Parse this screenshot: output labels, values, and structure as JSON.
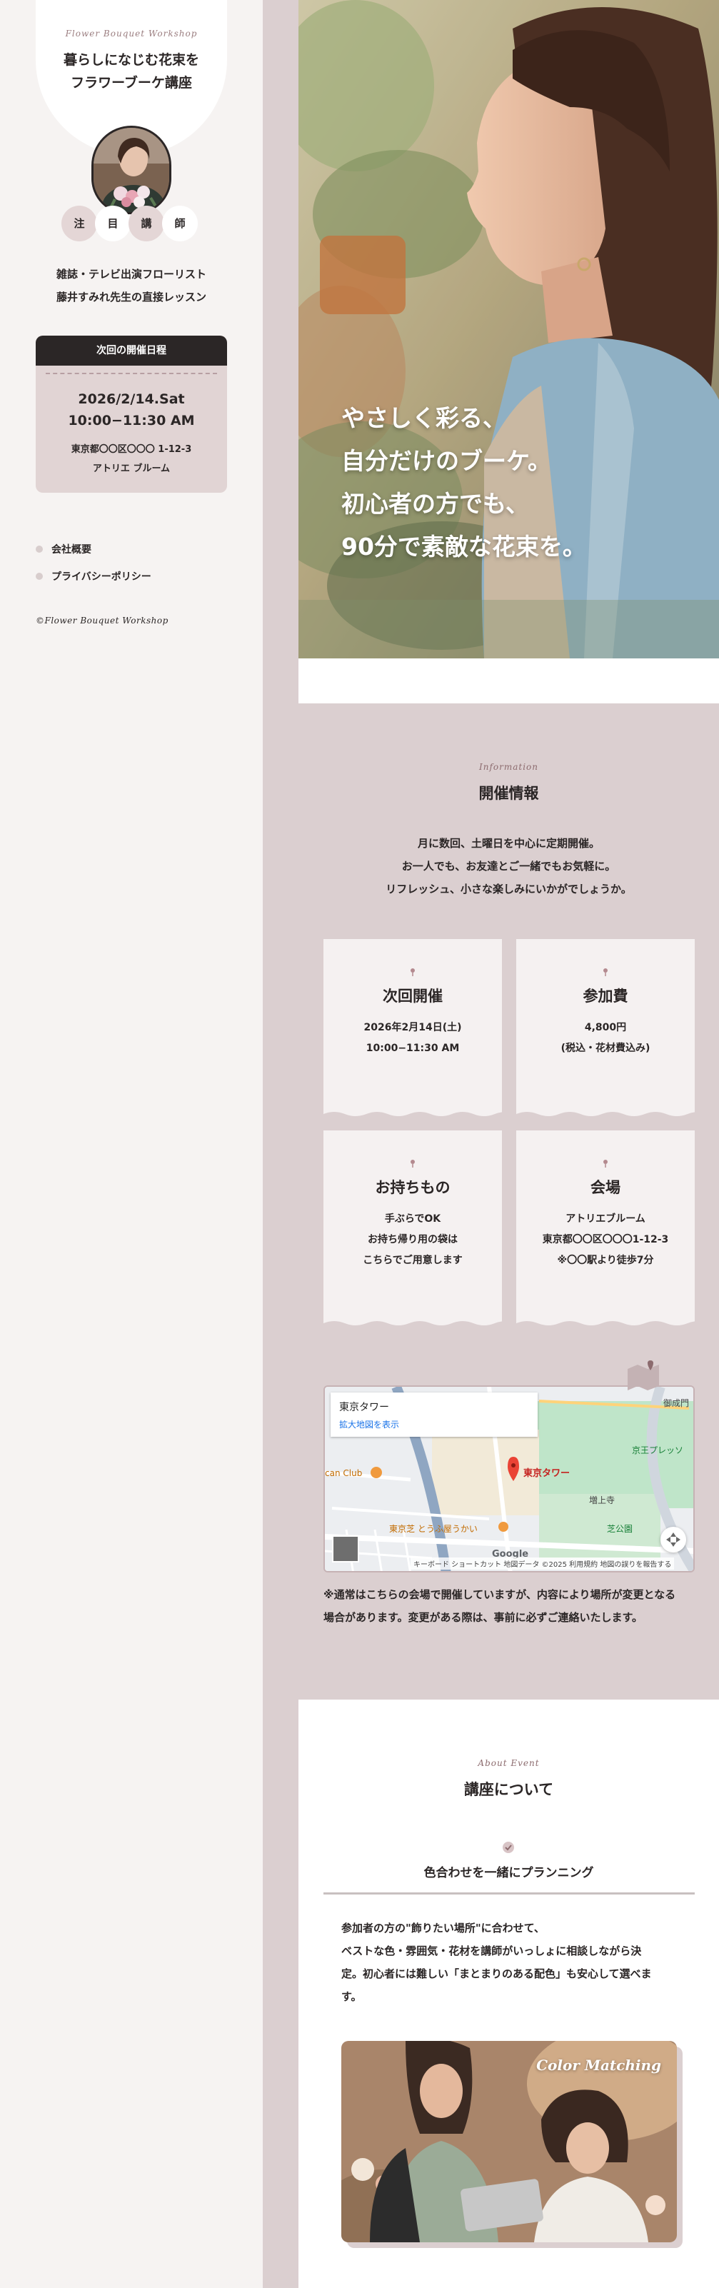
{
  "sidebar": {
    "brand_en": "Flower Bouquet Workshop",
    "brand_title_line1": "暮らしになじむ花束を",
    "brand_title_line2": "フラワーブーケ講座",
    "chips": [
      "注",
      "目",
      "講",
      "師"
    ],
    "lead_line1": "雑誌・テレビ出演フローリスト",
    "lead_line2": "藤井すみれ先生の直接レッスン",
    "event": {
      "heading": "次回の開催日程",
      "date": "2026/2/14.Sat",
      "time": "10:00−11:30 AM",
      "address": "東京都〇〇区〇〇〇 1-12-3",
      "venue": "アトリエ ブルーム"
    },
    "nav": [
      "会社概要",
      "プライバシーポリシー"
    ],
    "copyright": "©Flower Bouquet Workshop"
  },
  "hero": {
    "line1": "やさしく彩る、",
    "line2": "自分だけのブーケ。",
    "line3": "初心者の方でも、",
    "line4": "90分で素敵な花束を。"
  },
  "info": {
    "en": "Information",
    "title": "開催情報",
    "lead_line1": "月に数回、土曜日を中心に定期開催。",
    "lead_line2": "お一人でも、お友達とご一緒でもお気軽に。",
    "lead_line3": "リフレッシュ、小さな楽しみにいかがでしょうか。",
    "cards": [
      {
        "title": "次回開催",
        "lines": [
          "2026年2月14日(土)",
          "10:00−11:30 AM"
        ]
      },
      {
        "title": "参加費",
        "lines": [
          "4,800円",
          "(税込・花材費込み)"
        ]
      },
      {
        "title": "お持ちもの",
        "lines": [
          "手ぶらでOK",
          "お持ち帰り用の袋は",
          "こちらでご用意します"
        ]
      },
      {
        "title": "会場",
        "lines": [
          "アトリエブルーム",
          "東京都〇〇区〇〇〇1-12-3",
          "※〇〇駅より徒歩7分"
        ]
      }
    ],
    "map": {
      "place_title": "東京タワー",
      "enlarge_link": "拡大地図を表示",
      "marker_label": "東京タワー",
      "labels": [
        "御成門",
        "京王プレッソ",
        "増上寺",
        "芝公園",
        "東京芝 とうふ屋うかい",
        "can Club"
      ],
      "google": "Google",
      "footer": "キーボード ショートカット   地図データ ©2025   利用規約   地図の誤りを報告する"
    },
    "note_line1": "※通常はこちらの会場で開催していますが、内容により場所が変更となる",
    "note_line2": "場合があります。変更がある際は、事前に必ずご連絡いたします。"
  },
  "about": {
    "en": "About Event",
    "title": "講座について",
    "feature_title": "色合わせを一緒にプランニング",
    "body_line1": "参加者の方の\"飾りたい場所\"に合わせて、",
    "body_line2": "ベストな色・雰囲気・花材を講師がいっしょに相談しながら決",
    "body_line3": "定。初心者には難しい「まとまりのある配色」も安心して選べま",
    "body_line4": "す。",
    "photo_tag": "Color Matching"
  },
  "colors": {
    "accent": "#dbcfd0",
    "dark": "#2b2626",
    "card": "#f5f1f1",
    "sidebar": "#f6f3f2"
  }
}
